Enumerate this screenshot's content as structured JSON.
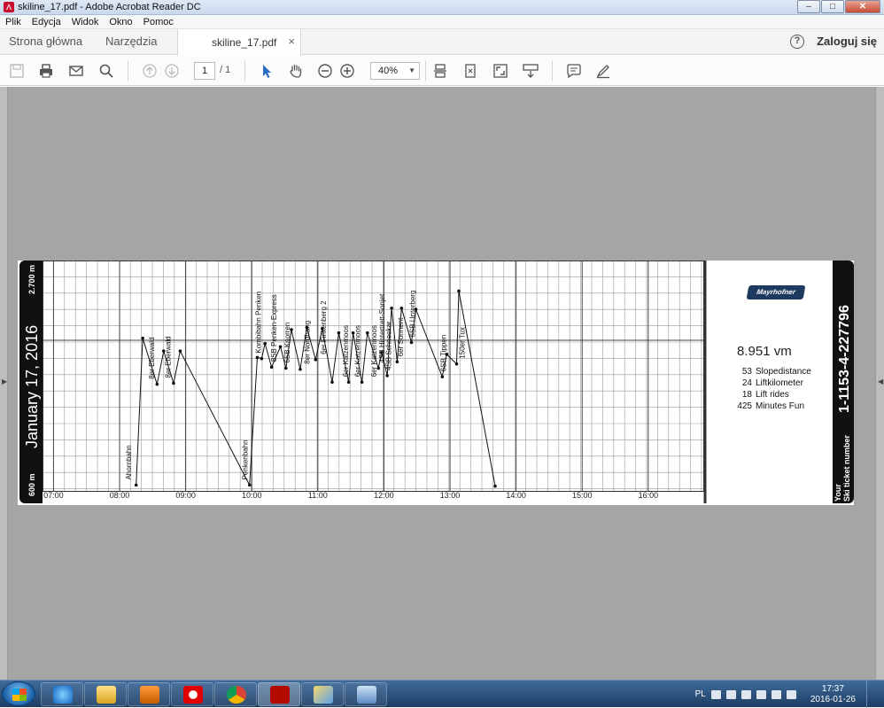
{
  "window": {
    "title": "skiline_17.pdf - Adobe Acrobat Reader DC"
  },
  "menu": [
    "Plik",
    "Edycja",
    "Widok",
    "Okno",
    "Pomoc"
  ],
  "tabs": {
    "home": "Strona główna",
    "tools": "Narzędzia",
    "document": "skiline_17.pdf",
    "login": "Zaloguj się"
  },
  "toolbar": {
    "page_current": "1",
    "page_total": "/ 1",
    "zoom": "40%"
  },
  "ticket": {
    "date": "January 17, 2016",
    "alt_top": "2.700 m",
    "alt_bottom": "600 m",
    "vertical_meters": "8.951 vm",
    "stats": [
      {
        "value": "53",
        "label": "Slopedistance"
      },
      {
        "value": "24",
        "label": "Liftkilometer"
      },
      {
        "value": "18",
        "label": "Lift rides"
      },
      {
        "value": "425",
        "label": "Minutes Fun"
      }
    ],
    "number": "1-1153-4-227796",
    "number_label_1": "Your",
    "number_label_2": "Ski ticket number",
    "logo": "Mayrhofner"
  },
  "chart_data": {
    "type": "line",
    "x_unit": "time",
    "xlim": [
      "06:50",
      "16:50"
    ],
    "ylim": [
      600,
      2700
    ],
    "x_ticks": [
      "07:00",
      "08:00",
      "09:00",
      "10:00",
      "11:00",
      "12:00",
      "13:00",
      "14:00",
      "15:00",
      "16:00"
    ],
    "y_ticks": [
      "600 m",
      "2.700 m"
    ],
    "grid": true,
    "points": [
      [
        "08:15",
        630
      ],
      [
        "08:21",
        2000
      ],
      [
        "08:34",
        1570
      ],
      [
        "08:40",
        1880
      ],
      [
        "08:49",
        1580
      ],
      [
        "08:55",
        1880
      ],
      [
        "09:58",
        630
      ],
      [
        "10:05",
        1820
      ],
      [
        "10:09",
        1810
      ],
      [
        "10:12",
        1950
      ],
      [
        "10:18",
        1730
      ],
      [
        "10:26",
        1920
      ],
      [
        "10:31",
        1720
      ],
      [
        "10:36",
        2080
      ],
      [
        "10:44",
        1710
      ],
      [
        "10:50",
        2100
      ],
      [
        "10:58",
        1800
      ],
      [
        "11:04",
        2090
      ],
      [
        "11:13",
        1590
      ],
      [
        "11:19",
        2050
      ],
      [
        "11:28",
        1590
      ],
      [
        "11:32",
        2050
      ],
      [
        "11:40",
        1590
      ],
      [
        "11:45",
        2050
      ],
      [
        "11:55",
        1720
      ],
      [
        "11:58",
        1870
      ],
      [
        "12:03",
        1650
      ],
      [
        "12:07",
        2280
      ],
      [
        "12:12",
        1780
      ],
      [
        "12:16",
        2280
      ],
      [
        "12:25",
        1960
      ],
      [
        "12:29",
        2270
      ],
      [
        "12:53",
        1640
      ],
      [
        "12:57",
        1850
      ],
      [
        "13:06",
        1760
      ],
      [
        "13:08",
        2440
      ],
      [
        "13:41",
        620
      ]
    ],
    "annotations": [
      {
        "label": "Ahornbahn",
        "x": "08:12",
        "y": 630
      },
      {
        "label": "8er Eberwald",
        "x": "08:33",
        "y": 1570
      },
      {
        "label": "8er Eberwald",
        "x": "08:48",
        "y": 1580
      },
      {
        "label": "Penkenbahn",
        "x": "09:58",
        "y": 630
      },
      {
        "label": "Kombibahn Penken",
        "x": "10:10",
        "y": 1810
      },
      {
        "label": "8SB Penken-Express",
        "x": "10:24",
        "y": 1730
      },
      {
        "label": "6SB Knorren",
        "x": "10:36",
        "y": 1720
      },
      {
        "label": "8er Nordhang",
        "x": "10:54",
        "y": 1710
      },
      {
        "label": "6er Finkenberg 2",
        "x": "11:09",
        "y": 1800
      },
      {
        "label": "6er Katzenmoos",
        "x": "11:29",
        "y": 1590
      },
      {
        "label": "6er Katzenmoos",
        "x": "11:40",
        "y": 1590
      },
      {
        "label": "6er Katzenmoos",
        "x": "11:55",
        "y": 1590
      },
      {
        "label": "4SB Hintertrett-Sonjet",
        "x": "12:02",
        "y": 1720
      },
      {
        "label": "4SB Schneekar",
        "x": "12:08",
        "y": 1650
      },
      {
        "label": "6er Sonnent",
        "x": "12:19",
        "y": 1780
      },
      {
        "label": "6SB Unterberg",
        "x": "12:30",
        "y": 1960
      },
      {
        "label": "6SB Tippen",
        "x": "12:58",
        "y": 1640
      },
      {
        "label": "150er Tux",
        "x": "13:15",
        "y": 1760
      }
    ]
  }
}
